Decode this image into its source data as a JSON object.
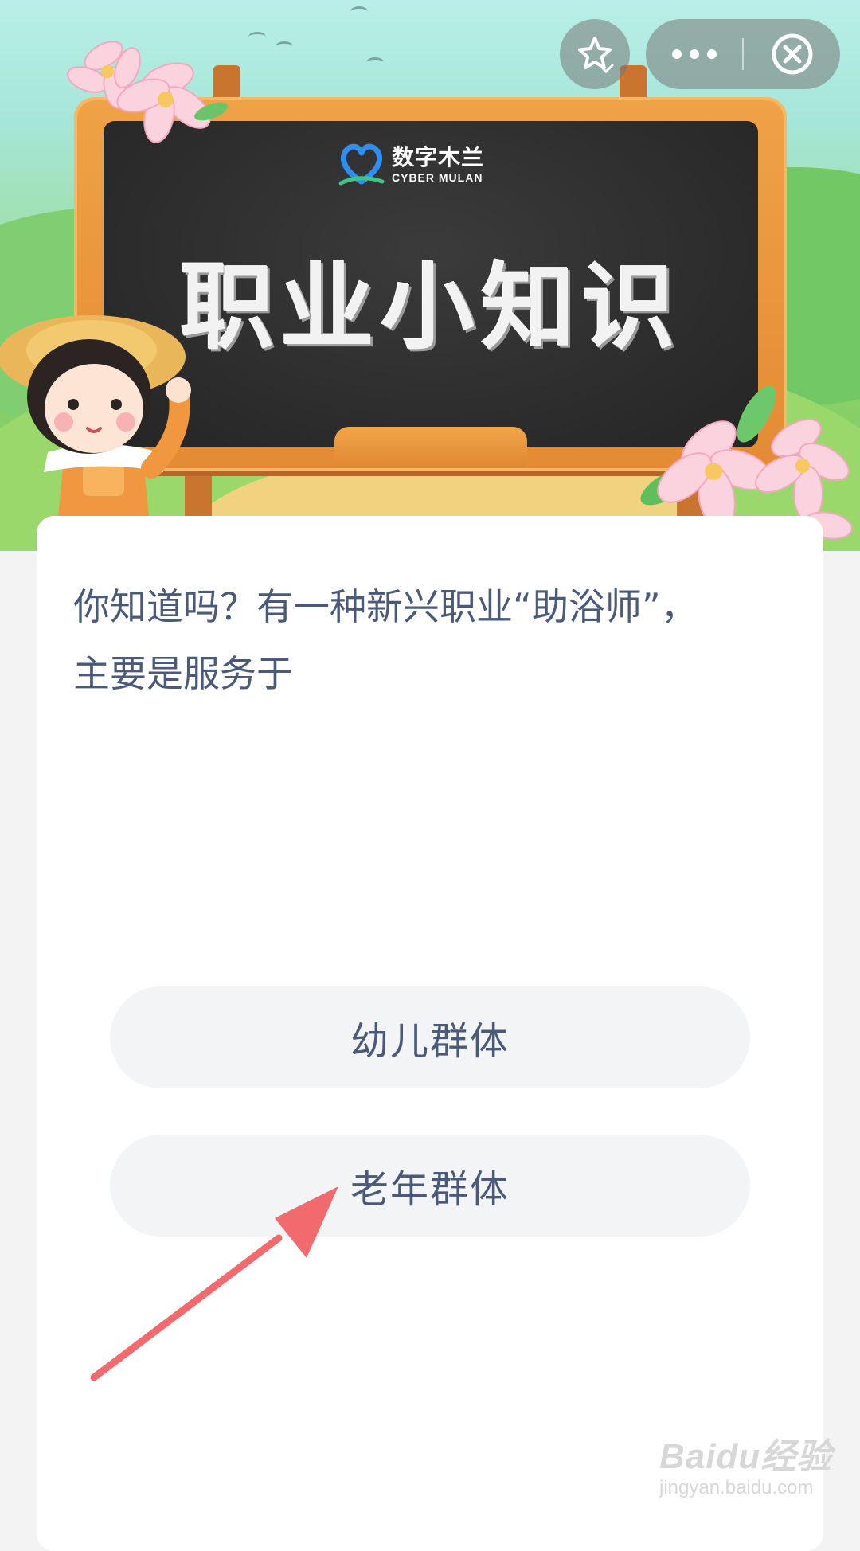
{
  "header": {
    "logo_cn": "数字木兰",
    "logo_en": "CYBER MULAN",
    "board_title": "职业小知识",
    "favorite_icon": "star-icon",
    "more_icon": "more-dots-icon",
    "close_icon": "close-circle-icon"
  },
  "question": {
    "text": "你知道吗？有一种新兴职业“助浴师”，主要是服务于"
  },
  "options": [
    {
      "label": "幼儿群体"
    },
    {
      "label": "老年群体"
    }
  ],
  "watermark": {
    "brand": "Baidu经验",
    "url": "jingyan.baidu.com"
  },
  "colors": {
    "text": "#4a5a78",
    "option_bg": "#f3f4f6",
    "arrow": "#f06a6e",
    "board_frame": "#e38b34",
    "board": "#2b2b2b"
  }
}
